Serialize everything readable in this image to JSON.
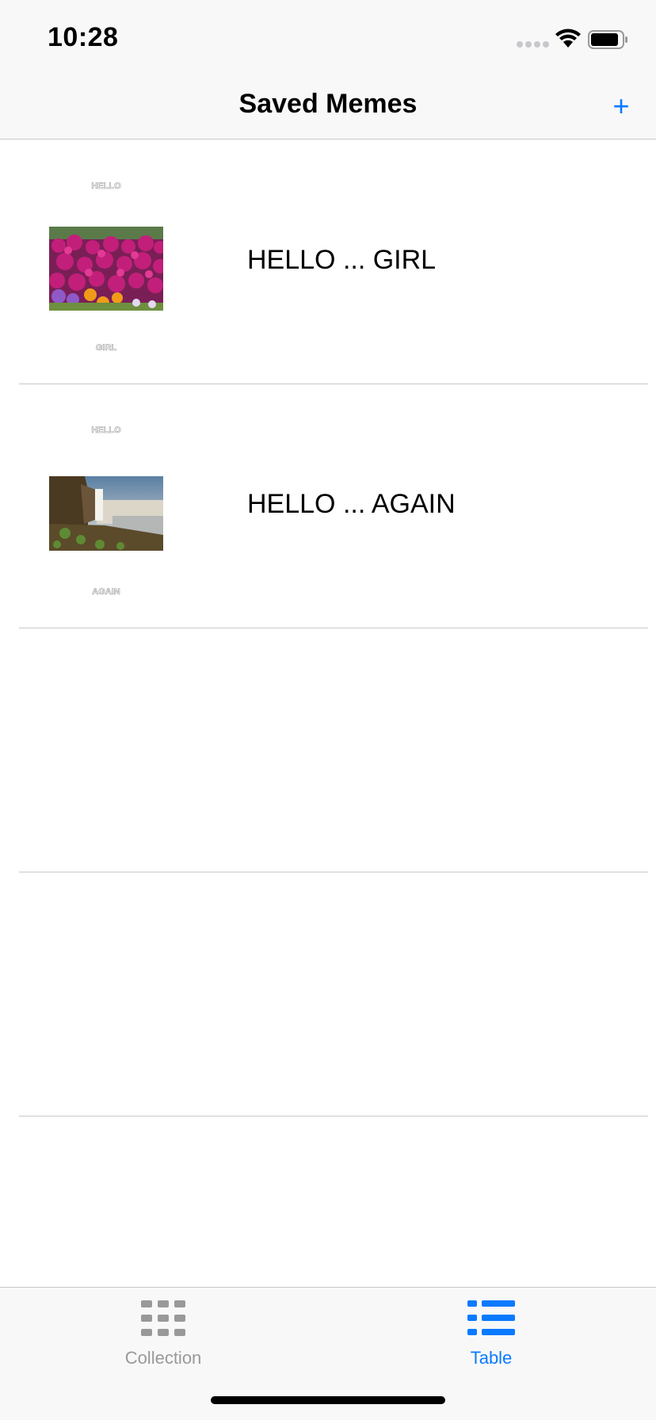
{
  "status_bar": {
    "time": "10:28"
  },
  "nav_bar": {
    "title": "Saved Memes",
    "add_label": "+"
  },
  "memes": [
    {
      "label": "HELLO ... GIRL",
      "top_text": "HELLO",
      "bottom_text": "GIRL",
      "image": "pink-flowers-photo"
    },
    {
      "label": "HELLO ... AGAIN",
      "top_text": "HELLO",
      "bottom_text": "AGAIN",
      "image": "waterfall-photo"
    }
  ],
  "tab_bar": {
    "tabs": [
      {
        "label": "Collection",
        "icon": "grid-icon",
        "selected": false
      },
      {
        "label": "Table",
        "icon": "list-icon",
        "selected": true
      }
    ],
    "selected_color": "#0a7aff",
    "unselected_color": "#999999"
  }
}
